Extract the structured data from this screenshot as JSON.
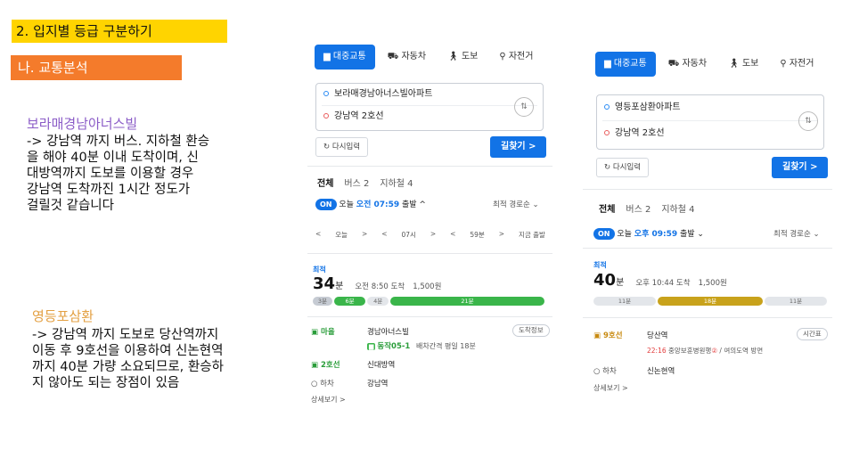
{
  "slide": {
    "header1": "2. 입지별 등급 구분하기",
    "header2": "나. 교통분석",
    "loc1_title": "보라매경남아너스빌",
    "loc1_body": "-> 강남역 까지 버스. 지하철 환승\n을 해야 40분 이내 도착이며, 신\n대방역까지 도보를 이용할 경우\n강남역 도착까진 1시간 정도가\n걸릴것 같습니다",
    "loc2_title": "영등포삼환",
    "loc2_body": "-> 강남역 까지 도보로 당산역까지\n이동 후 9호선을 이용하여 신논현역\n까지 40분 가량 소요되므로, 환승하\n지 않아도 되는 장점이 있음"
  },
  "panel1": {
    "tabs": [
      "대중교통",
      "자동차",
      "도보",
      "자전거"
    ],
    "origin": "보라매경남아너스빌아파트",
    "destination": "강남역 2호선",
    "reset": "다시입력",
    "find": "길찾기 >",
    "subtabs": [
      "전체",
      "버스 2",
      "지하철 4"
    ],
    "on": "ON",
    "departure_prefix": "오늘 ",
    "departure_time": "오전 07:59",
    "departure_suffix": " 출발 ^",
    "sort": "최적 경로순 ⌄",
    "nav": [
      "<",
      "오늘",
      ">",
      "<",
      "07시",
      ">",
      "<",
      "59분",
      ">",
      "지금 출발"
    ],
    "fast_label": "최적",
    "minutes": "34",
    "min_unit": "분",
    "arrive": "오전 8:50 도착",
    "fare": "1,500원",
    "bar": [
      "3분",
      "6분",
      "4분",
      "21분"
    ],
    "steps": {
      "s1_line": "마을",
      "s1_stop": "경남아너스빌",
      "s1_info": "도착정보",
      "s1_bus": "동작05-1",
      "s1_interval": "배차간격 평일 18분",
      "s2_line": "2호선",
      "s2_stop": "신대방역",
      "s3_label": "하차",
      "s3_stop": "강남역",
      "more": "상세보기 >"
    }
  },
  "panel2": {
    "tabs": [
      "대중교통",
      "자동차",
      "도보",
      "자전거"
    ],
    "origin": "영등포삼환아파트",
    "destination": "강남역 2호선",
    "reset": "다시입력",
    "find": "길찾기 >",
    "subtabs": [
      "전체",
      "버스 2",
      "지하철 4"
    ],
    "on": "ON",
    "departure_prefix": "오늘 ",
    "departure_time": "오후 09:59",
    "departure_suffix": " 출발 ⌄",
    "sort": "최적 경로순 ⌄",
    "fast_label": "최적",
    "minutes": "40",
    "min_unit": "분",
    "arrive": "오후 10:44 도착",
    "fare": "1,500원",
    "bar": [
      "11분",
      "18분",
      "11분"
    ],
    "steps": {
      "s1_line": "9호선",
      "s1_stop": "당산역",
      "s1_info": "시간표",
      "s1_time": "22:16",
      "s1_detail_a": " 중앙보훈병원행",
      "s1_detail_num": "②",
      "s1_detail_b": " / 여의도역 방면",
      "s2_label": "하차",
      "s2_stop": "신논현역",
      "more": "상세보기 >"
    }
  },
  "colors": {
    "yellow_header": "#ffd400",
    "orange_header": "#f47b2b",
    "accent_blue": "#1273e6",
    "subway_green": "#3ab54a",
    "subway_gold": "#c8a21b",
    "purple_title": "#8b5cc7",
    "orange_title": "#e3a043"
  }
}
